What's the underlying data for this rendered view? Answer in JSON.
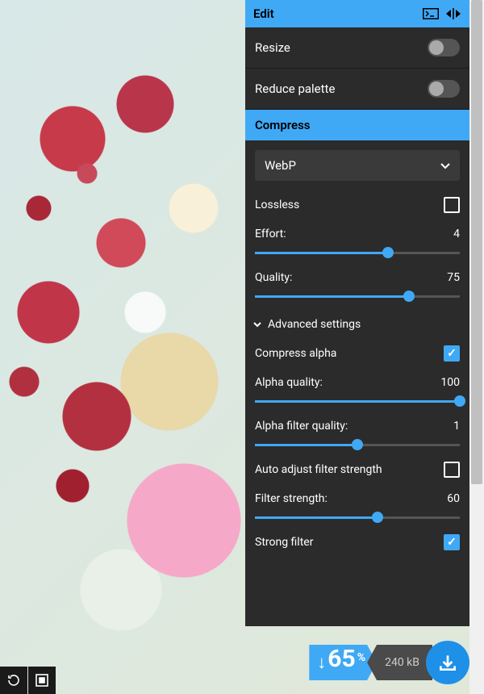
{
  "header": {
    "title": "Edit"
  },
  "edit": {
    "resize_label": "Resize",
    "reduce_palette_label": "Reduce palette"
  },
  "compress": {
    "section_label": "Compress",
    "format": "WebP",
    "lossless_label": "Lossless",
    "lossless": false,
    "effort_label": "Effort:",
    "effort_value": "4",
    "effort_pct": 65,
    "quality_label": "Quality:",
    "quality_value": "75",
    "quality_pct": 75,
    "advanced_label": "Advanced settings",
    "compress_alpha_label": "Compress alpha",
    "compress_alpha": true,
    "alpha_quality_label": "Alpha quality:",
    "alpha_quality_value": "100",
    "alpha_quality_pct": 100,
    "alpha_filter_label": "Alpha filter quality:",
    "alpha_filter_value": "1",
    "alpha_filter_pct": 50,
    "auto_filter_label": "Auto adjust filter strength",
    "auto_filter": false,
    "filter_strength_label": "Filter strength:",
    "filter_strength_value": "60",
    "filter_strength_pct": 60,
    "strong_filter_label": "Strong filter",
    "strong_filter": true
  },
  "output": {
    "reduction": "65",
    "reduction_unit": "%",
    "size": "240 kB"
  }
}
